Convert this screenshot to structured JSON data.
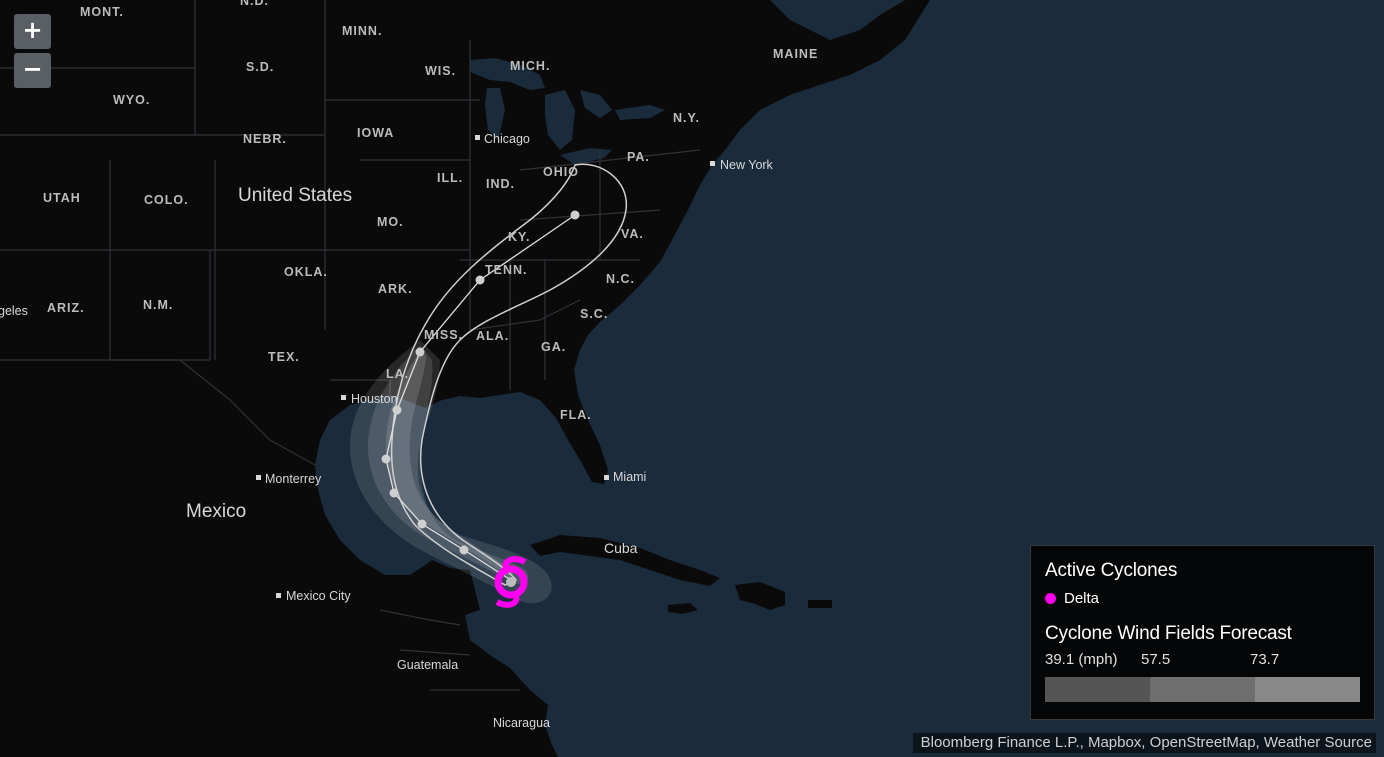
{
  "map": {
    "zoom_in_label": "+",
    "zoom_out_label": "−",
    "colors": {
      "ocean": "#1a2b3c",
      "land": "#0a0a0b",
      "border": "#2f3338",
      "cone": "#ffffff",
      "storm": "#ff00ee"
    },
    "state_labels": [
      "MONT.",
      "N.D.",
      "MINN.",
      "S.D.",
      "WIS.",
      "MICH.",
      "MAINE",
      "WYO.",
      "IOWA",
      "NEBR.",
      "N.Y.",
      "PA.",
      "ILL.",
      "IND.",
      "OHIO",
      "UTAH",
      "COLO.",
      "MO.",
      "KY.",
      "VA.",
      "OKLA.",
      "TENN.",
      "N.C.",
      "ARK.",
      "ARIZ.",
      "N.M.",
      "S.C.",
      "MISS.",
      "ALA.",
      "GA.",
      "TEX.",
      "LA.",
      "FLA."
    ],
    "country_labels": [
      "United States",
      "Mexico",
      "Cuba"
    ],
    "city_labels": [
      "Chicago",
      "New York",
      "Houston",
      "Monterrey",
      "Miami",
      "Mexico City",
      "Guatemala",
      "Nicaragua"
    ],
    "partial_labels": [
      "geles"
    ]
  },
  "legend": {
    "active_title": "Active Cyclones",
    "storm_name": "Delta",
    "storm_color": "#ff00ee",
    "wind_title": "Cyclone Wind Fields Forecast",
    "scale_values": [
      "39.1 (mph)",
      "57.5",
      "73.7"
    ],
    "scale_colors": [
      "#555555",
      "#6e6e6e",
      "#888888"
    ]
  },
  "attribution": "Bloomberg Finance L.P., Mapbox, OpenStreetMap, Weather Source"
}
